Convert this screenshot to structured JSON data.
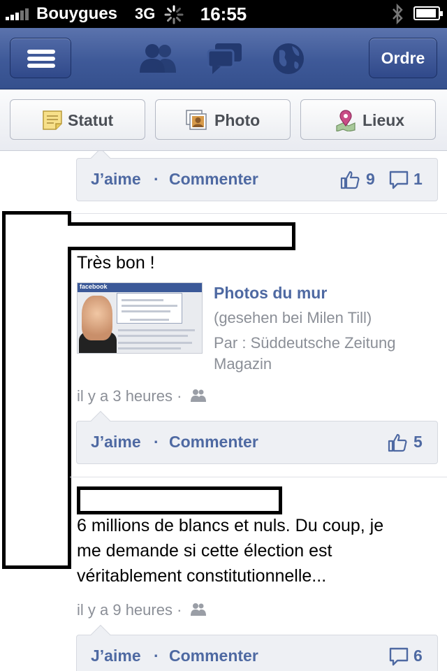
{
  "status_bar": {
    "carrier": "Bouygues",
    "network": "3G",
    "time": "16:55"
  },
  "nav": {
    "order_button": "Ordre",
    "icons": [
      "menu-icon",
      "friends-icon",
      "messages-icon",
      "globe-icon"
    ]
  },
  "publisher": {
    "status_label": "Statut",
    "photo_label": "Photo",
    "places_label": "Lieux"
  },
  "feed": {
    "first_story": {
      "like_label": "J’aime",
      "comment_label": "Commenter",
      "separator": "·",
      "like_count": "9",
      "comment_count": "1"
    },
    "second_story": {
      "text": "Très bon !",
      "attachment": {
        "title": "Photos du mur",
        "line1": "(gesehen bei Milen Till)",
        "line2": "Par : Süddeutsche Zeitung",
        "line3": "Magazin"
      },
      "time": "il y a 3 heures ·",
      "like_label": "J’aime",
      "comment_label": "Commenter",
      "separator": "·",
      "like_count": "5"
    },
    "third_story": {
      "text_line1": "6 millions de blancs et nuls. Du coup, je",
      "text_line2": "me demande si cette élection est",
      "text_line3": "véritablement constitutionnelle...",
      "time": "il y a 9 heures ·",
      "like_label": "J’aime",
      "comment_label": "Commenter",
      "separator": "·",
      "comment_count": "6"
    }
  },
  "colors": {
    "nav_blue": "#3e5998",
    "link_blue": "#4e69a2",
    "meta_gray": "#8b8f97"
  }
}
